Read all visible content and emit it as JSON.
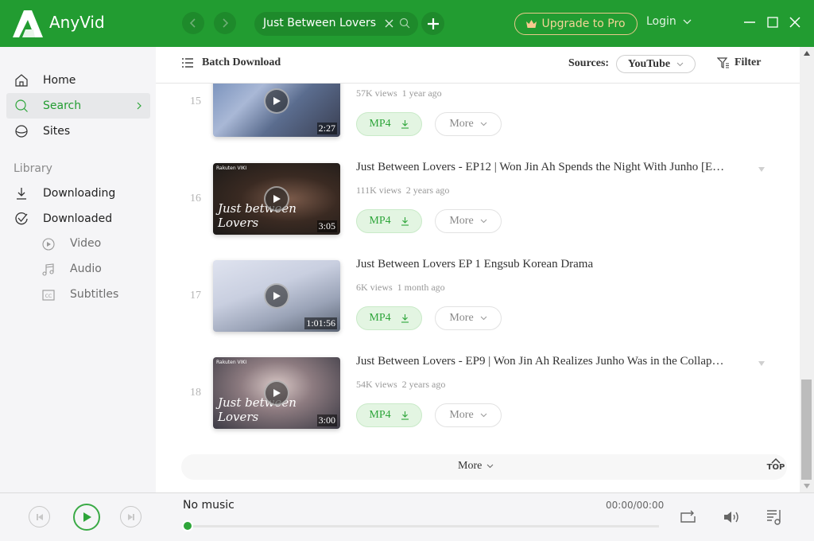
{
  "app": {
    "name": "AnyVid",
    "search_query": "Just Between Lovers",
    "upgrade_label": "Upgrade to Pro",
    "login_label": "Login",
    "colors": {
      "brand": "#229c31",
      "accent_green": "#2ea53a",
      "upgrade_gold": "#f3d596"
    }
  },
  "sidebar": {
    "items": [
      {
        "label": "Home",
        "icon": "home-icon"
      },
      {
        "label": "Search",
        "icon": "search-icon",
        "active": true
      },
      {
        "label": "Sites",
        "icon": "globe-icon"
      }
    ],
    "library_label": "Library",
    "library_items": [
      {
        "label": "Downloading",
        "icon": "download-icon"
      },
      {
        "label": "Downloaded",
        "icon": "check-circle-icon"
      }
    ],
    "sub_items": [
      {
        "label": "Video",
        "icon": "video-icon"
      },
      {
        "label": "Audio",
        "icon": "music-icon"
      },
      {
        "label": "Subtitles",
        "icon": "cc-icon"
      }
    ]
  },
  "toolbar": {
    "batch_label": "Batch Download",
    "sources_label": "Sources:",
    "sources_value": "YouTube",
    "filter_label": "Filter"
  },
  "results": [
    {
      "index": "15",
      "title": "",
      "views": "57K views",
      "age": "1 year ago",
      "duration": "2:27",
      "format": "MP4",
      "more": "More"
    },
    {
      "index": "16",
      "title": "Just Between Lovers - EP12 | Won Jin Ah Spends the Night With Junho [E…",
      "views": "111K views",
      "age": "2 years ago",
      "duration": "3:05",
      "format": "MP4",
      "more": "More",
      "brand": "Rakuten VIKI",
      "overlay": "Just between Lovers"
    },
    {
      "index": "17",
      "title": "Just Between Lovers EP 1 Engsub Korean Drama",
      "views": "6K views",
      "age": "1 month ago",
      "duration": "1:01:56",
      "format": "MP4",
      "more": "More"
    },
    {
      "index": "18",
      "title": "Just Between Lovers - EP9 | Won Jin Ah Realizes Junho Was in the Collap…",
      "views": "54K views",
      "age": "2 years ago",
      "duration": "3:00",
      "format": "MP4",
      "more": "More",
      "brand": "Rakuten VIKI",
      "overlay": "Just between Lovers"
    }
  ],
  "load_more_label": "More",
  "top_label": "TOP",
  "player": {
    "now_playing": "No music",
    "time": "00:00/00:00",
    "progress": 0
  }
}
